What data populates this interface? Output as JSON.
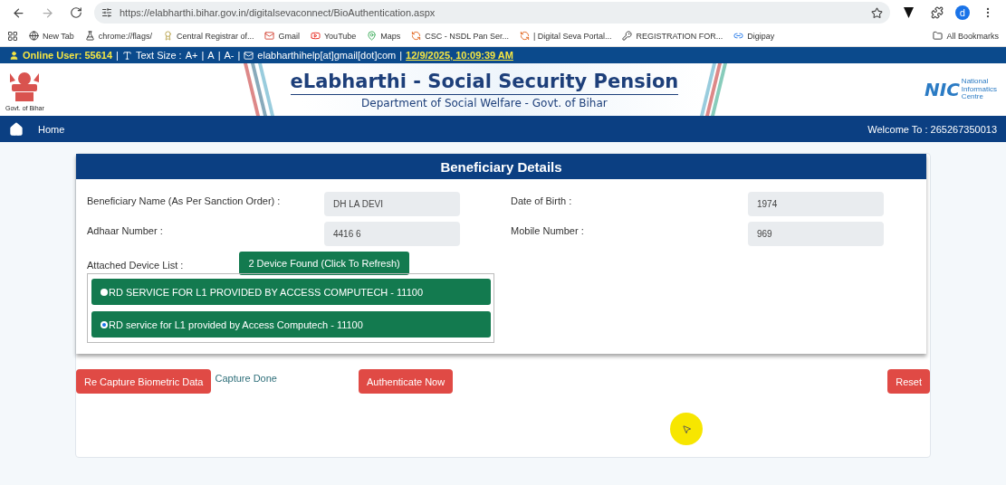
{
  "browser": {
    "url": "https://elabharthi.bihar.gov.in/digitalsevaconnect/BioAuthentication.aspx",
    "profile": "d",
    "bookmarks": [
      {
        "kind": "globe",
        "label": "New Tab"
      },
      {
        "kind": "flask",
        "label": "chrome://flags/"
      },
      {
        "kind": "seal",
        "label": "Central Registrar of..."
      },
      {
        "kind": "mail",
        "label": "Gmail"
      },
      {
        "kind": "video",
        "label": "YouTube"
      },
      {
        "kind": "pin",
        "label": "Maps"
      },
      {
        "kind": "swirl",
        "label": "CSC - NSDL Pan Ser..."
      },
      {
        "kind": "swirl",
        "label": "| Digital Seva Portal..."
      },
      {
        "kind": "key",
        "label": "REGISTRATION FOR..."
      },
      {
        "kind": "link",
        "label": "Digipay"
      }
    ],
    "all_bookmarks": "All Bookmarks"
  },
  "info_bar": {
    "online_user": "Online User: 55614",
    "sep": "|",
    "text_size": "Text Size :",
    "sizes": [
      "A+",
      "A",
      "A-"
    ],
    "email": "elabharthihelp[at]gmail[dot]com",
    "datetime": "12/9/2025, 10:09:39 AM"
  },
  "header": {
    "emblem_caption": "Govt. of Bihar",
    "title": "eLabharthi - Social Security Pension",
    "subtitle": "Department of Social Welfare - Govt. of Bihar",
    "nic": "NIC",
    "nic_name": [
      "National",
      "Informatics",
      "Centre"
    ]
  },
  "nav": {
    "home": "Home",
    "welcome": "Welcome To : 265267350013"
  },
  "card": {
    "title": "Beneficiary Details",
    "fields": [
      {
        "label": "Beneficiary Name (As Per Sanction Order) :",
        "value": "DH LA DEVI"
      },
      {
        "label": "Date of Birth :",
        "value": "1974"
      },
      {
        "label": "Adhaar Number :",
        "value": "4416 6"
      },
      {
        "label": "Mobile Number :",
        "value": "969"
      }
    ],
    "device_label": "Attached Device List :",
    "refresh_button": "2 Device Found (Click To Refresh)",
    "devices": [
      {
        "label": "RD SERVICE FOR L1 PROVIDED BY ACCESS COMPUTECH - 11100",
        "selected": false
      },
      {
        "label": "RD service for L1 provided by Access Computech - 11100",
        "selected": true
      }
    ]
  },
  "actions": {
    "recapture": "Re Capture Biometric Data",
    "status": "Capture Done",
    "authenticate": "Authenticate Now",
    "reset": "Reset"
  }
}
